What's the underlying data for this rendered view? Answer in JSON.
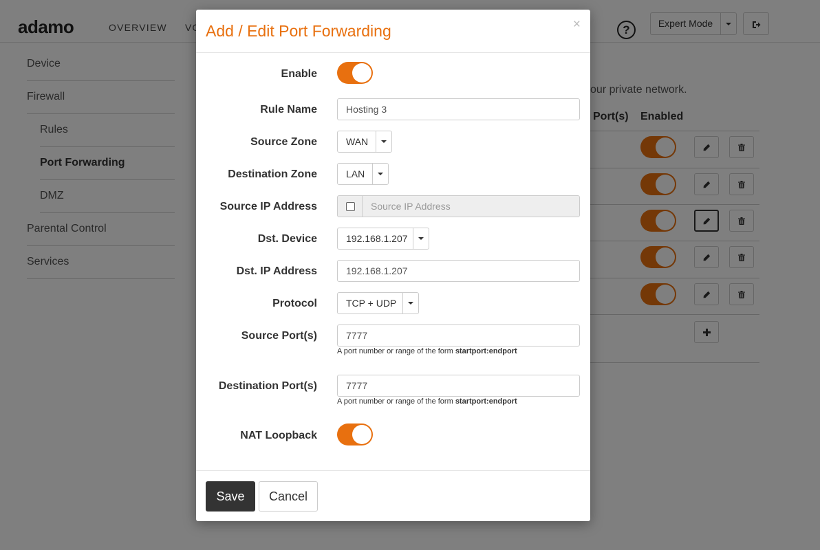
{
  "app": {
    "logo": "adamo",
    "nav": [
      "OVERVIEW",
      "VO"
    ],
    "mode_label": "Expert Mode",
    "help_icon": "question-circle-icon",
    "logout_icon": "logout-icon"
  },
  "sidebar": {
    "items": [
      {
        "label": "Device",
        "level": 0,
        "active": false
      },
      {
        "label": "Firewall",
        "level": 0,
        "active": false
      },
      {
        "label": "Rules",
        "level": 1,
        "active": false
      },
      {
        "label": "Port Forwarding",
        "level": 1,
        "active": true
      },
      {
        "label": "DMZ",
        "level": 1,
        "active": false
      },
      {
        "label": "Parental Control",
        "level": 0,
        "active": false
      },
      {
        "label": "Services",
        "level": 0,
        "active": false
      }
    ]
  },
  "background_table": {
    "description_fragment": "our private network.",
    "header_ports": "Port(s)",
    "header_enabled": "Enabled",
    "rows": 5,
    "edit_icon": "pencil-icon",
    "delete_icon": "trash-icon",
    "add_icon": "plus-icon"
  },
  "modal": {
    "title": "Add / Edit Port Forwarding",
    "close": "×",
    "fields": {
      "enable": {
        "label": "Enable",
        "value": true
      },
      "rule_name": {
        "label": "Rule Name",
        "value": "Hosting 3"
      },
      "source_zone": {
        "label": "Source Zone",
        "value": "WAN"
      },
      "destination_zone": {
        "label": "Destination Zone",
        "value": "LAN"
      },
      "source_ip": {
        "label": "Source IP Address",
        "placeholder": "Source IP Address",
        "checked": false
      },
      "dst_device": {
        "label": "Dst. Device",
        "value": "192.168.1.207"
      },
      "dst_ip": {
        "label": "Dst. IP Address",
        "value": "192.168.1.207"
      },
      "protocol": {
        "label": "Protocol",
        "value": "TCP + UDP"
      },
      "source_ports": {
        "label": "Source Port(s)",
        "value": "7777"
      },
      "destination_ports": {
        "label": "Destination Port(s)",
        "value": "7777"
      },
      "nat_loopback": {
        "label": "NAT Loopback",
        "value": true
      }
    },
    "port_help_text": "A port number or range of the form ",
    "port_help_bold": "startport:endport",
    "save_label": "Save",
    "cancel_label": "Cancel"
  },
  "colors": {
    "accent": "#e8700f",
    "primary_button": "#333333",
    "overlay": "rgba(0,0,0,0.5)"
  }
}
